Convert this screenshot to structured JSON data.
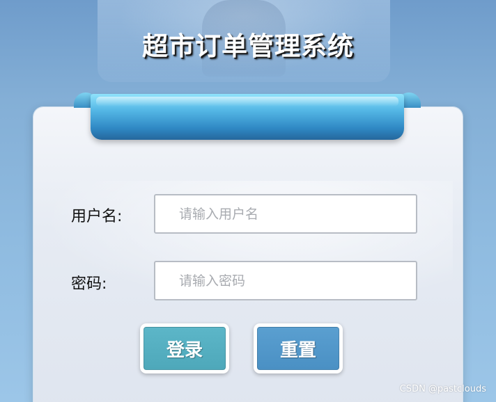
{
  "header": {
    "title": "超市订单管理系统"
  },
  "login_form": {
    "username_label": "用户名:",
    "username_placeholder": "请输入用户名",
    "username_value": "",
    "password_label": "密码:",
    "password_placeholder": "请输入密码",
    "password_value": "",
    "login_button": "登录",
    "reset_button": "重置"
  },
  "watermark": "CSDN @pastclouds",
  "colors": {
    "login_button": "#52adbf",
    "reset_button": "#4f96c9",
    "ribbon": "#3a8fc4",
    "background": "#8fbbe0"
  }
}
